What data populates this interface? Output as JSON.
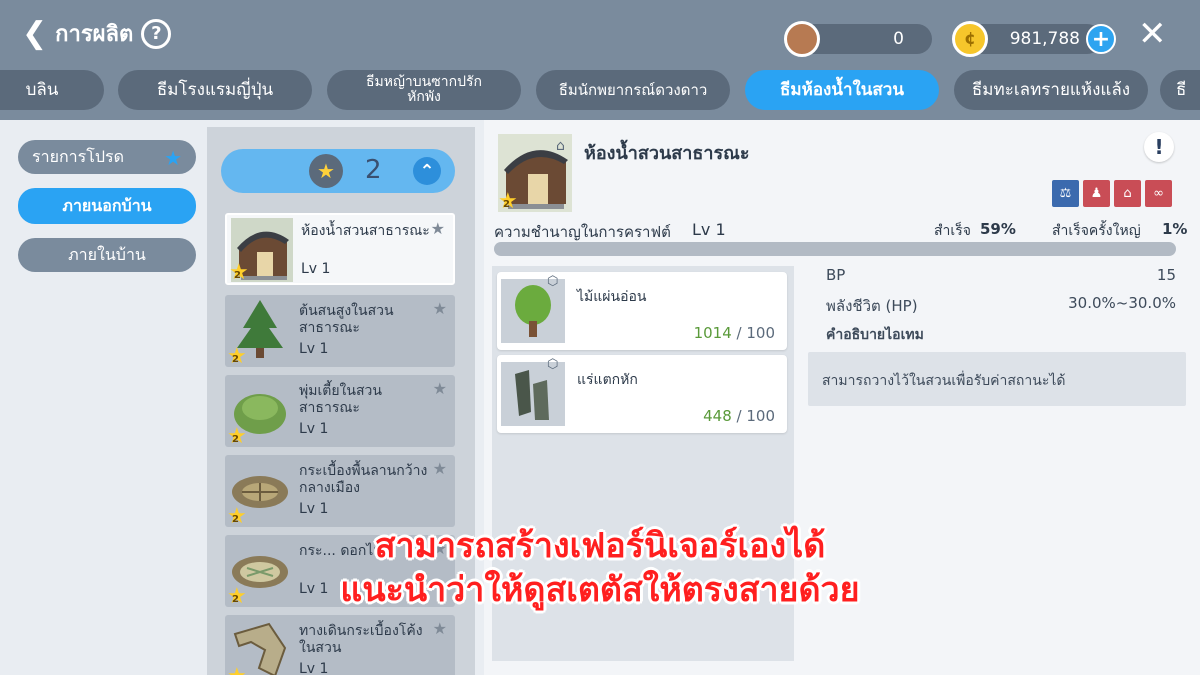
{
  "header": {
    "title": "การผลิต",
    "currency_copper": "0",
    "currency_gold": "981,788"
  },
  "tabs": [
    {
      "label": "บลิน"
    },
    {
      "label": "ธีมโรงแรมญี่ปุ่น"
    },
    {
      "label": "ธีมหญ้าบนซากปรักหักพัง"
    },
    {
      "label": "ธีมนักพยากรณ์ดวงดาว"
    },
    {
      "label": "ธีมห้องน้ำในสวน"
    },
    {
      "label": "ธีมทะเลทรายแห้งแล้ง"
    },
    {
      "label": "ธี"
    }
  ],
  "left_menu": [
    {
      "label": "รายการโปรด"
    },
    {
      "label": "ภายนอกบ้าน"
    },
    {
      "label": "ภายในบ้าน"
    }
  ],
  "filter": {
    "count": "2"
  },
  "recipes": [
    {
      "name": "ห้องน้ำสวนสาธารณะ",
      "lv": "Lv 1",
      "rank": "2"
    },
    {
      "name": "ต้นสนสูงในสวนสาธารณะ",
      "lv": "Lv 1",
      "rank": "2"
    },
    {
      "name": "พุ่มเตี้ยในสวนสาธารณะ",
      "lv": "Lv 1",
      "rank": "2"
    },
    {
      "name": "กระเบื้องพื้นลานกว้างกลางเมือง",
      "lv": "Lv 1",
      "rank": "2"
    },
    {
      "name": "กระ... ดอกไม้",
      "lv": "Lv 1",
      "rank": "2"
    },
    {
      "name": "ทางเดินกระเบื้องโค้งในสวน",
      "lv": "Lv 1",
      "rank": "2"
    }
  ],
  "detail": {
    "name": "ห้องน้ำสวนสาธารณะ",
    "rank": "2",
    "craft_label": "ความชำนาญในการคราฟต์",
    "craft_lv": "Lv 1",
    "success_label": "สำเร็จ",
    "success_value": "59%",
    "big_success_label": "สำเร็จครั้งใหญ่",
    "big_success_value": "1%",
    "materials": [
      {
        "name": "ไม้แผ่นอ่อน",
        "have": "1014",
        "need": "/ 100"
      },
      {
        "name": "แร่แตกหัก",
        "have": "448",
        "need": "/ 100"
      }
    ],
    "stats": [
      {
        "label": "BP",
        "value": "15"
      },
      {
        "label": "พลังชีวิต (HP)",
        "value": "30.0%~30.0%"
      }
    ],
    "desc_title": "คำอธิบายไอเทม",
    "desc_text": "สามารถวางไว้ในสวนเพื่อรับค่าสถานะได้"
  },
  "caption": {
    "line1": "สามารถสร้างเฟอร์นิเจอร์เองได้",
    "line2": "แนะนำว่าให้ดูสเตตัสให้ตรงสายด้วย"
  },
  "colors": {
    "header_bg": "#7a8b9d",
    "tab_active": "#2aa3f3",
    "caption": "#ff1f1f"
  }
}
